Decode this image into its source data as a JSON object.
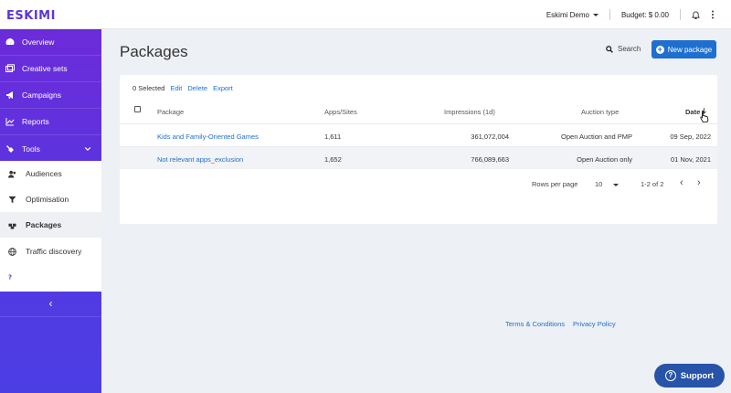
{
  "brand": {
    "logo_text": "ESKIMI",
    "accent": "#6c2bd9",
    "primary": "#1f6fd0"
  },
  "topbar": {
    "account": "Eskimi Demo",
    "budget": "Budget: $ 0.00"
  },
  "sidebar": {
    "items": [
      {
        "label": "Overview",
        "icon": "dashboard-icon"
      },
      {
        "label": "Creative sets",
        "icon": "images-icon"
      },
      {
        "label": "Campaigns",
        "icon": "megaphone-icon"
      },
      {
        "label": "Reports",
        "icon": "chart-icon"
      },
      {
        "label": "Tools",
        "icon": "tools-icon"
      }
    ],
    "tools": [
      {
        "label": "Audiences",
        "icon": "users-icon"
      },
      {
        "label": "Optimisation",
        "icon": "filter-icon"
      },
      {
        "label": "Packages",
        "icon": "boxes-icon"
      },
      {
        "label": "Traffic discovery",
        "icon": "globe-icon"
      }
    ],
    "help": "Help",
    "collapse": "‹"
  },
  "page": {
    "title": "Packages",
    "search": "Search",
    "new_button": "New package"
  },
  "table": {
    "selected": "0 Selected",
    "actions": [
      "Edit",
      "Delete",
      "Export"
    ],
    "columns": [
      "Package",
      "Apps/Sites",
      "Impressions (1d)",
      "Auction type",
      "Date"
    ],
    "rows": [
      {
        "package": "Kids and Family-Oriented Games",
        "apps": "1,611",
        "impressions": "361,072,004",
        "auction": "Open Auction and PMP",
        "date": "09 Sep, 2022"
      },
      {
        "package": "Not relevant apps_exclusion",
        "apps": "1,652",
        "impressions": "766,089,663",
        "auction": "Open Auction only",
        "date": "01 Nov, 2021"
      }
    ],
    "pager": {
      "rows_label": "Rows per page",
      "rows_value": "10",
      "range": "1-2 of 2",
      "prev": "‹",
      "next": "›"
    }
  },
  "footer": {
    "terms": "Terms & Conditions",
    "privacy": "Privacy Policy"
  },
  "support": {
    "label": "Support",
    "icon": "?"
  }
}
